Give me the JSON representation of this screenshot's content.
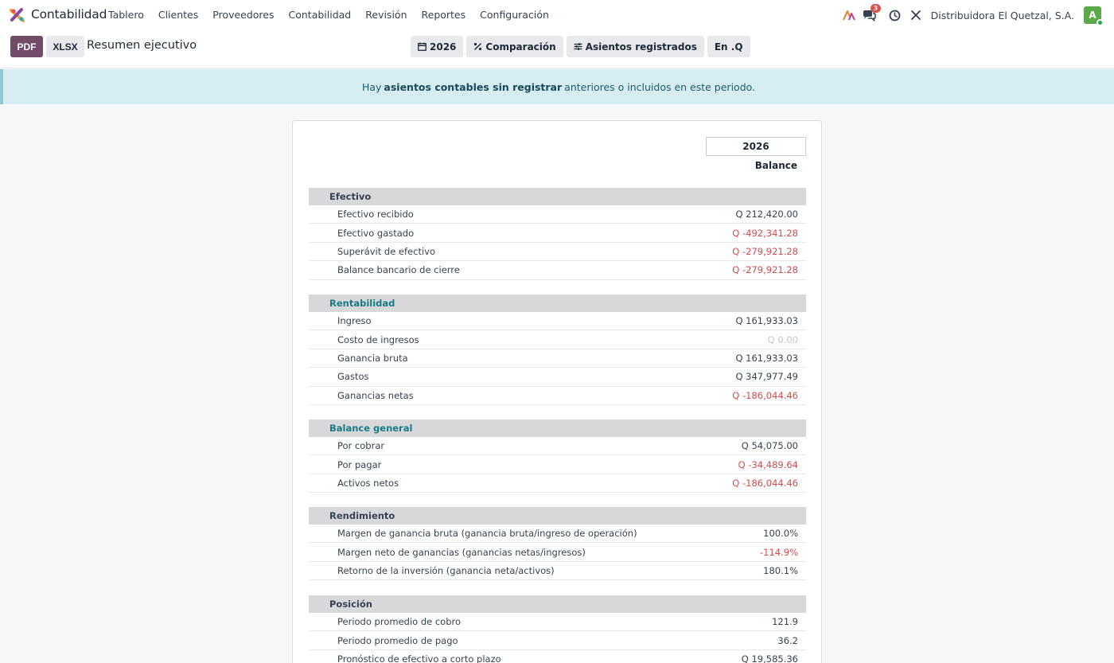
{
  "navbar": {
    "app_name": "Contabilidad",
    "menu": [
      "Tablero",
      "Clientes",
      "Proveedores",
      "Contabilidad",
      "Revisión",
      "Reportes",
      "Configuración"
    ],
    "messages_count": "3",
    "company": "Distribuidora El Quetzal, S.A.",
    "avatar_letter": "A",
    "avatar_color": "#5aaa48"
  },
  "control": {
    "pdf_label": "PDF",
    "xlsx_label": "XLSX",
    "title": "Resumen ejecutivo",
    "filters": {
      "year": "2026",
      "comparison": "Comparación",
      "posted": "Asientos registrados",
      "currency": "En .Q"
    }
  },
  "alert": {
    "prefix": "Hay",
    "link": "asientos contables sin registrar",
    "suffix": "anteriores o incluidos en este periodo."
  },
  "report": {
    "period": "2026",
    "column": "Balance",
    "sections": [
      {
        "title": "Efectivo",
        "style": "default",
        "rows": [
          {
            "label": "Efectivo recibido",
            "value": "Q 212,420.00",
            "tone": "normal"
          },
          {
            "label": "Efectivo gastado",
            "value": "Q -492,341.28",
            "tone": "neg"
          },
          {
            "label": "Superávit de efectivo",
            "value": "Q -279,921.28",
            "tone": "neg"
          },
          {
            "label": "Balance bancario de cierre",
            "value": "Q -279,921.28",
            "tone": "neg"
          }
        ]
      },
      {
        "title": "Rentabilidad",
        "style": "teal",
        "rows": [
          {
            "label": "Ingreso",
            "value": "Q 161,933.03",
            "tone": "normal"
          },
          {
            "label": "Costo de ingresos",
            "value": "Q 0.00",
            "tone": "muted"
          },
          {
            "label": "Ganancia bruta",
            "value": "Q 161,933.03",
            "tone": "normal"
          },
          {
            "label": "Gastos",
            "value": "Q 347,977.49",
            "tone": "normal"
          },
          {
            "label": "Ganancias netas",
            "value": "Q -186,044.46",
            "tone": "neg"
          }
        ]
      },
      {
        "title": "Balance general",
        "style": "teal",
        "rows": [
          {
            "label": "Por cobrar",
            "value": "Q 54,075.00",
            "tone": "normal"
          },
          {
            "label": "Por pagar",
            "value": "Q -34,489.64",
            "tone": "neg"
          },
          {
            "label": "Activos netos",
            "value": "Q -186,044.46",
            "tone": "neg"
          }
        ]
      },
      {
        "title": "Rendimiento",
        "style": "default",
        "rows": [
          {
            "label": "Margen de ganancia bruta (ganancia bruta/ingreso de operación)",
            "value": "100.0%",
            "tone": "normal"
          },
          {
            "label": "Margen neto de ganancias (ganancias netas/ingresos)",
            "value": "-114.9%",
            "tone": "neg"
          },
          {
            "label": "Retorno de la inversión (ganancia neta/activos)",
            "value": "180.1%",
            "tone": "normal"
          }
        ]
      },
      {
        "title": "Posición",
        "style": "default",
        "rows": [
          {
            "label": "Periodo promedio de cobro",
            "value": "121.9",
            "tone": "normal"
          },
          {
            "label": "Periodo promedio de pago",
            "value": "36.2",
            "tone": "normal"
          },
          {
            "label": "Pronóstico de efectivo a corto plazo",
            "value": "Q 19,585.36",
            "tone": "normal"
          }
        ]
      }
    ]
  }
}
